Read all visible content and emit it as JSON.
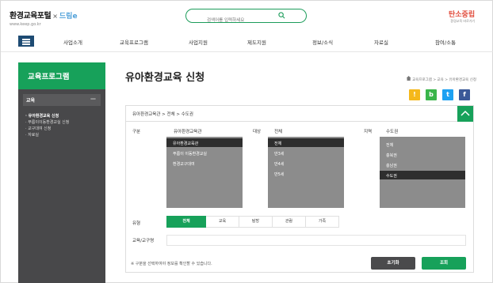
{
  "header": {
    "logo_text": "환경교육포털",
    "logo_x": "×",
    "logo_partner": "드림e",
    "logo_url": "www.keep.go.kr",
    "search_placeholder": "검색어를 입력하세요",
    "brand": "탄소중립",
    "brand_sub": "환경교육 바로가기"
  },
  "nav": {
    "items": [
      "사업소개",
      "교육프로그램",
      "사업지원",
      "제도지원",
      "정보/소식",
      "자료실",
      "참여/소통"
    ]
  },
  "sidebar": {
    "title": "교육프로그램",
    "section": "교육",
    "collapse": "—",
    "items": [
      "유아환경교육 신청",
      "푸름이이동환경교실 신청",
      "교구대여 신청",
      "자료실"
    ]
  },
  "page": {
    "title": "유아환경교육 신청",
    "breadcrumb": "교육프로그램 > 교육 > 유아환경교육 신청"
  },
  "share": [
    {
      "label": "!",
      "color": "#f5b81b"
    },
    {
      "label": "b",
      "color": "#3ab54a"
    },
    {
      "label": "t",
      "color": "#1da1f2"
    },
    {
      "label": "f",
      "color": "#3b5998"
    }
  ],
  "panel": {
    "path": "유아환경교육관 > 전체 > 수도권",
    "gubun_label": "구분",
    "gubun_selected": "유아환경교육관",
    "gubun_options": [
      "유아환경교육관",
      "푸름이 이동환경교실",
      "환경교구대여"
    ],
    "target_label": "대상",
    "target_selected": "전체",
    "target_options": [
      "전체",
      "만3세",
      "만4세",
      "만5세"
    ],
    "region_label": "지역",
    "region_selected": "수도권",
    "region_options": [
      "전체",
      "충북권",
      "충남권",
      "수도권"
    ],
    "type_label": "유형",
    "type_options": [
      "전체",
      "교육",
      "탐방",
      "관람",
      "가족"
    ],
    "field_label": "교육/교구명",
    "note": "※ 구분을 선택하여야 정보를 확인할 수 있습니다.",
    "reset_label": "초기화",
    "search_label": "조회"
  },
  "colors": {
    "green": "#17a15a",
    "navy": "#1e4b73",
    "sidebar": "#48484a"
  }
}
